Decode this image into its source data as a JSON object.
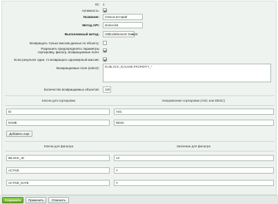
{
  "form": {
    "id_label": "ID:",
    "id_value": "1",
    "active_label": "Активность:",
    "name_label": "Название:",
    "name_value": "Список историй",
    "api_method_label": "Метод API:",
    "api_method_value": "stories.list",
    "executed_method_label": "Выполняемый метод:",
    "executed_method_value": "CIBlockElement::GetList",
    "only_count_label": "Возвращать только массив данных по объекту:",
    "allow_override_label_1": "Разрешить предопределять параметры",
    "allow_override_label_2": "сортировку, фильтр, возвращаемые поля:",
    "single_result_label": "Если результат один, то возвращать одномерный массив:",
    "return_fields_label": "Возвращаемые поля (select):",
    "return_fields_value": "ID,IBLOCK_ID,NAME,PROPERTY_*",
    "count_label": "Количество возвращаемых объектов:",
    "count_value": "100",
    "checkboxes": {
      "active": true,
      "only_count": false,
      "allow_override": true,
      "single_result": true
    }
  },
  "sort_table": {
    "col_keys": "Ключи для сортировки",
    "col_dirs": "Направление сортировки (ASC или DESC)",
    "rows": [
      {
        "key": "ID",
        "dir": "ASC"
      },
      {
        "key": "NAME",
        "dir": "DESC"
      }
    ],
    "add_button": "Добавить ещё"
  },
  "filter_table": {
    "col_keys": "Ключи для фильтра",
    "col_values": "Значение для фильтра",
    "rows": [
      {
        "key": "IBLOCK_ID",
        "value": "13"
      },
      {
        "key": "ACTIVE",
        "value": "Y"
      },
      {
        "key": "ACTIVE_DATE",
        "value": "Y"
      }
    ]
  },
  "footer": {
    "save": "Сохранить",
    "apply": "Применить",
    "cancel": "Отменить"
  },
  "colors": {
    "accent": "#6bb52a",
    "panel": "#eef3ef"
  }
}
